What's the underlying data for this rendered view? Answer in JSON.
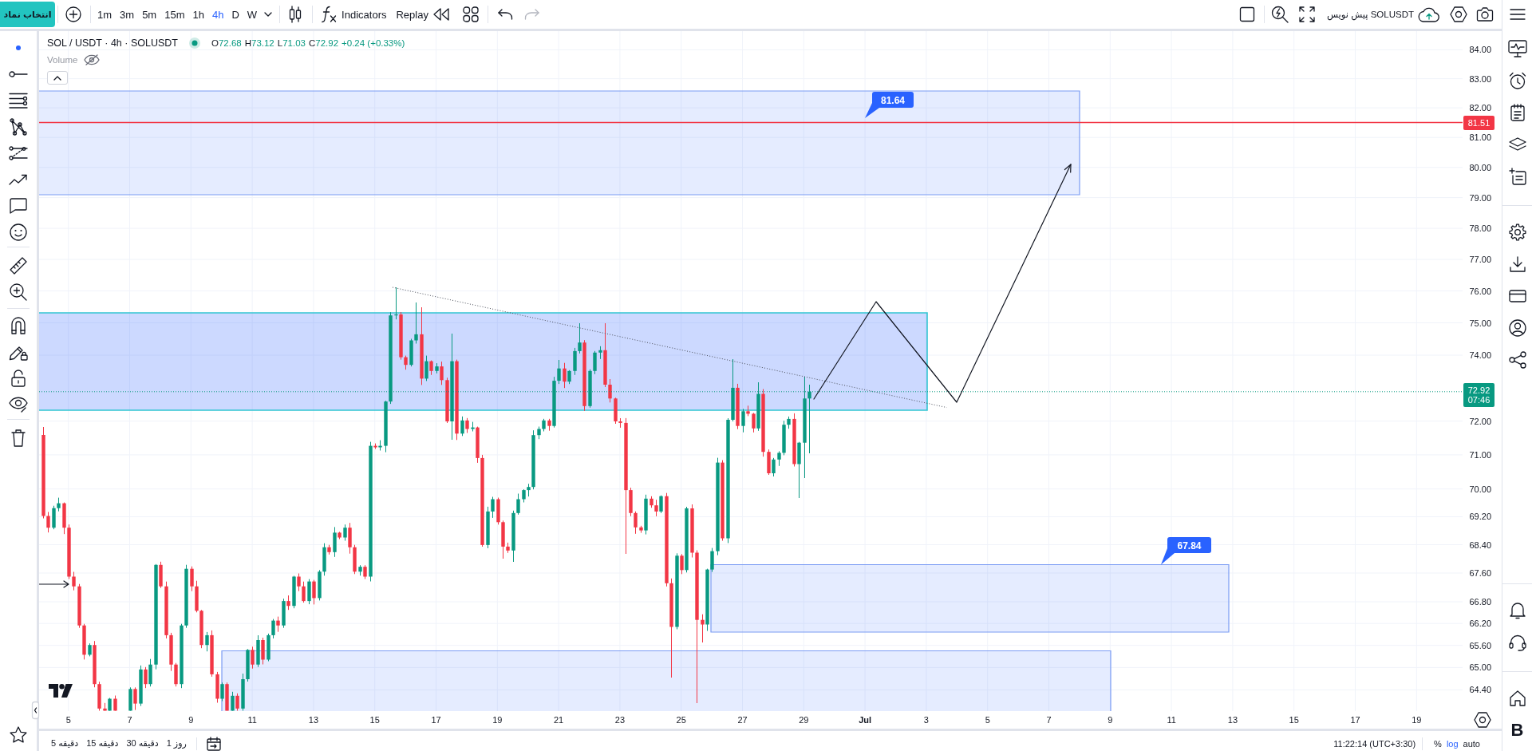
{
  "top_toolbar": {
    "symbol_button": {
      "label": "انتخاب نماد"
    },
    "intervals": [
      {
        "label": "1m",
        "selected": false
      },
      {
        "label": "3m",
        "selected": false
      },
      {
        "label": "5m",
        "selected": false
      },
      {
        "label": "15m",
        "selected": false
      },
      {
        "label": "1h",
        "selected": false
      },
      {
        "label": "4h",
        "selected": true
      },
      {
        "label": "D",
        "selected": false
      },
      {
        "label": "W",
        "selected": false
      }
    ],
    "indicators_button": {
      "label": "Indicators"
    },
    "replay_button": {
      "label": "Replay"
    },
    "undo": {
      "disabled": false
    },
    "redo": {
      "disabled": true
    },
    "layout_button": {
      "label": "پیش نویس SOLUSDT"
    }
  },
  "legend": {
    "title": "SOL / USDT · 4h · SOLUSDT",
    "ohlc": [
      {
        "key": "O",
        "value": "72.68"
      },
      {
        "key": "H",
        "value": "73.12"
      },
      {
        "key": "L",
        "value": "71.03"
      },
      {
        "key": "C",
        "value": "72.92"
      }
    ],
    "change": "+0.24 (+0.33%)",
    "volume": {
      "label": "Volume",
      "hidden": true
    }
  },
  "chart": {
    "price_labels": [
      {
        "label": "81.64"
      },
      {
        "label": "67.84"
      }
    ]
  },
  "price_axis": {
    "labels": [
      "84.00",
      "83.00",
      "82.00",
      "81.00",
      "80.00",
      "79.00",
      "78.00",
      "77.00",
      "76.00",
      "75.00",
      "74.00",
      "72.00",
      "71.00",
      "70.00",
      "69.20",
      "68.40",
      "67.60",
      "66.80",
      "66.20",
      "65.60",
      "65.00",
      "64.40"
    ],
    "tags": [
      {
        "color": "#f23645",
        "lines": [
          "81.51"
        ]
      },
      {
        "color": "#089981",
        "lines": [
          "72.92",
          "07:46"
        ]
      }
    ]
  },
  "time_axis": {
    "labels": [
      {
        "text": "5",
        "kind": "day"
      },
      {
        "text": "7",
        "kind": "day"
      },
      {
        "text": "9",
        "kind": "day"
      },
      {
        "text": "11",
        "kind": "day"
      },
      {
        "text": "13",
        "kind": "day"
      },
      {
        "text": "15",
        "kind": "day"
      },
      {
        "text": "17",
        "kind": "day"
      },
      {
        "text": "19",
        "kind": "day"
      },
      {
        "text": "21",
        "kind": "day"
      },
      {
        "text": "23",
        "kind": "day"
      },
      {
        "text": "25",
        "kind": "day"
      },
      {
        "text": "27",
        "kind": "day"
      },
      {
        "text": "29",
        "kind": "day"
      },
      {
        "text": "Jul",
        "kind": "month"
      },
      {
        "text": "3",
        "kind": "day"
      },
      {
        "text": "5",
        "kind": "day"
      },
      {
        "text": "7",
        "kind": "day"
      },
      {
        "text": "9",
        "kind": "day"
      },
      {
        "text": "11",
        "kind": "day"
      },
      {
        "text": "13",
        "kind": "day"
      },
      {
        "text": "15",
        "kind": "day"
      },
      {
        "text": "17",
        "kind": "day"
      },
      {
        "text": "19",
        "kind": "day"
      }
    ]
  },
  "bottom_bar": {
    "ranges": [
      {
        "label": "1 روز"
      },
      {
        "label": "30 دقیقه"
      },
      {
        "label": "15 دقیقه"
      },
      {
        "label": "5 دقیقه"
      }
    ],
    "clock": "11:22:14 (UTC+3:30)",
    "scale_options": [
      {
        "label": "%",
        "selected": false
      },
      {
        "label": "log",
        "selected": true
      },
      {
        "label": "auto",
        "selected": false
      }
    ]
  },
  "widget_bar": {
    "logo": "B"
  }
}
